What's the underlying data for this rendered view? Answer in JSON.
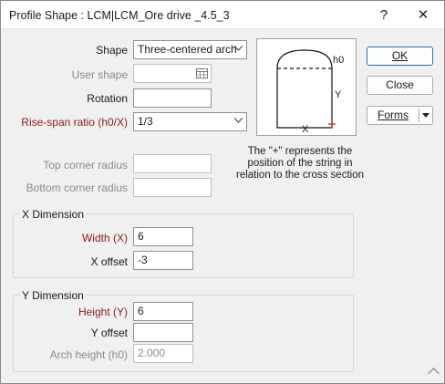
{
  "window": {
    "title": "Profile Shape : LCM|LCM_Ore drive _4.5_3",
    "help_glyph": "?",
    "close_glyph": "✕"
  },
  "form": {
    "shape_label": "Shape",
    "shape_value": "Three-centered arch",
    "user_shape_label": "User shape",
    "user_shape_value": "",
    "rotation_label": "Rotation",
    "rotation_value": "",
    "rise_span_label": "Rise-span ratio (h0/X)",
    "rise_span_value": "1/3",
    "top_corner_label": "Top corner radius",
    "top_corner_value": "",
    "bottom_corner_label": "Bottom corner radius",
    "bottom_corner_value": ""
  },
  "diagram": {
    "label_h0": "h0",
    "label_y": "Y",
    "label_x": "X",
    "caption": "The \"+\" represents the position of the string in relation to the cross section",
    "accent": "#d11a1a"
  },
  "x_dimension": {
    "title": "X Dimension",
    "width_label": "Width (X)",
    "width_value": "6",
    "offset_label": "X offset",
    "offset_value": "-3"
  },
  "y_dimension": {
    "title": "Y Dimension",
    "height_label": "Height (Y)",
    "height_value": "6",
    "offset_label": "Y offset",
    "offset_value": "",
    "arch_label": "Arch height (h0)",
    "arch_value": "2.000"
  },
  "buttons": {
    "ok": "OK",
    "close": "Close",
    "forms": "Forms"
  },
  "colors": {
    "required_label": "#8b1a1a",
    "disabled_label": "#8a8a8a",
    "default_button_border": "#3a6ea5"
  }
}
